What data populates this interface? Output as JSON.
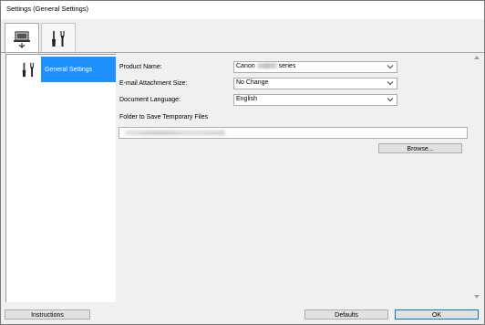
{
  "window": {
    "title": "Settings (General Settings)"
  },
  "tabs": [
    {
      "name": "scan-from-computer",
      "icon": "computer-scan-icon",
      "active": false
    },
    {
      "name": "general-settings",
      "icon": "tools-icon",
      "active": true
    }
  ],
  "sidebar": {
    "items": [
      {
        "label": "General Settings",
        "icon": "tools-icon",
        "selected": true
      }
    ]
  },
  "form": {
    "product_name": {
      "label": "Product Name:",
      "value_prefix": "Canon",
      "value_suffix": "series"
    },
    "email_attachment_size": {
      "label": "E-mail Attachment Size:",
      "value": "No Change"
    },
    "document_language": {
      "label": "Document Language:",
      "value": "English"
    },
    "temp_folder": {
      "label": "Folder to Save Temporary Files"
    },
    "browse_label": "Browse..."
  },
  "footer": {
    "instructions_label": "Instructions",
    "defaults_label": "Defaults",
    "ok_label": "OK"
  },
  "colors": {
    "selection": "#1e90ff",
    "ok_border": "#0078d7"
  }
}
